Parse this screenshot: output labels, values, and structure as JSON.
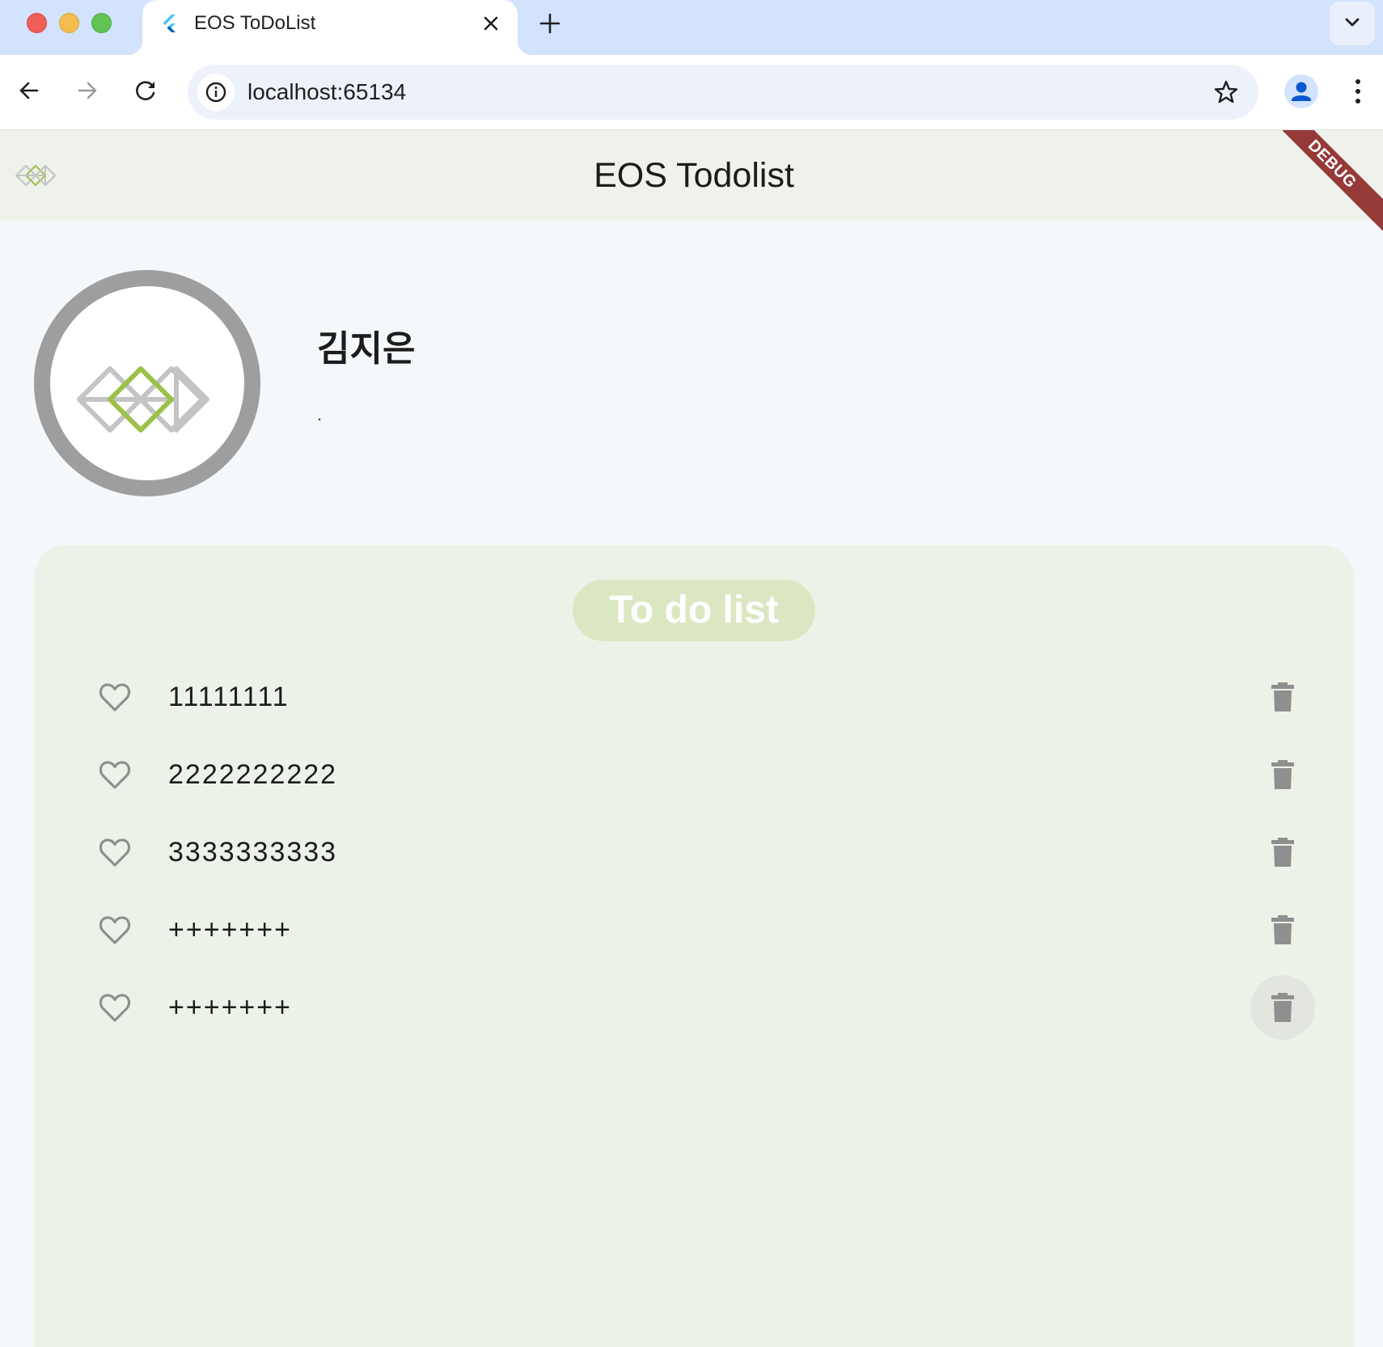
{
  "browser": {
    "tab_title": "EOS ToDoList",
    "url": "localhost:65134"
  },
  "app": {
    "title": "EOS Todolist",
    "debug_banner": "DEBUG",
    "profile": {
      "name": "김지은",
      "status": "."
    },
    "todo": {
      "header": "To do list",
      "items": [
        {
          "text": "11111111",
          "liked": false
        },
        {
          "text": "2222222222",
          "liked": false
        },
        {
          "text": "3333333333",
          "liked": false
        },
        {
          "text": "+++++++",
          "liked": false
        },
        {
          "text": "+++++++",
          "liked": false
        }
      ]
    }
  },
  "colors": {
    "appbar_bg": "#eef2ea",
    "panel_bg": "#edf2e9",
    "header_pill": "#dbe7c2",
    "logo_green": "#9cc14a",
    "logo_gray": "#c4c4c4",
    "icon_gray": "#8f8f8f"
  }
}
